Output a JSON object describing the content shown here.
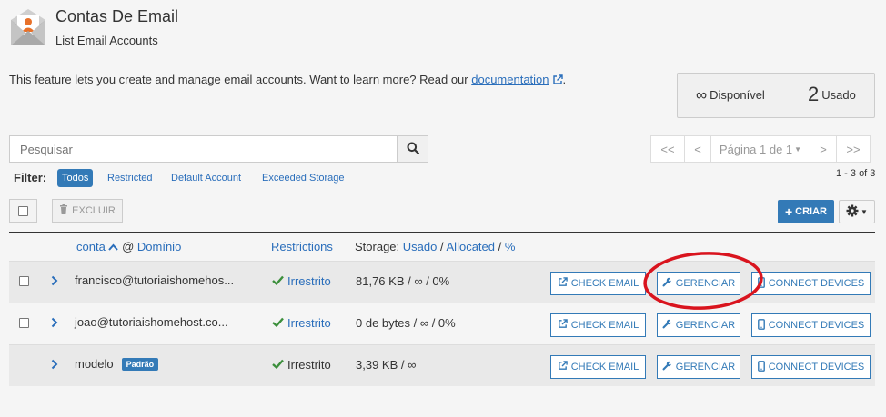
{
  "header": {
    "title": "Contas De Email",
    "subtitle": "List Email Accounts"
  },
  "intro": {
    "text": "This feature lets you create and manage email accounts. Want to learn more? Read our ",
    "link": "documentation",
    "suffix": "."
  },
  "stats": {
    "available_value": "∞",
    "available_label": "Disponível",
    "used_value": "2",
    "used_label": "Usado"
  },
  "search": {
    "placeholder": "Pesquisar"
  },
  "pagination": {
    "first": "<<",
    "prev": "<",
    "page_label": "Página 1 de 1",
    "next": ">",
    "last": ">>",
    "count": "1 - 3 of 3"
  },
  "filters": {
    "label": "Filter:",
    "items": [
      "Todos",
      "Restricted",
      "Default Account",
      "Exceeded Storage"
    ],
    "active": "Todos"
  },
  "toolbar": {
    "delete_label": "EXCLUIR",
    "create_label": "CRIAR"
  },
  "table": {
    "headers": {
      "account": "conta",
      "at": "@",
      "domain": "Domínio",
      "restrictions": "Restrictions",
      "storage_prefix": "Storage:",
      "storage_used": "Usado",
      "storage_sep1": "/",
      "storage_allocated": "Allocated",
      "storage_sep2": "/",
      "storage_pct": "%"
    },
    "rows": [
      {
        "email": "francisco@tutoriaishomehos...",
        "restriction": "Irrestrito",
        "storage": "81,76 KB / ∞ / 0%",
        "check_email": "CHECK EMAIL",
        "manage": "GERENCIAR",
        "connect": "CONNECT DEVICES"
      },
      {
        "email": "joao@tutoriaishomehost.co...",
        "restriction": "Irrestrito",
        "storage": "0 de bytes / ∞ / 0%",
        "check_email": "CHECK EMAIL",
        "manage": "GERENCIAR",
        "connect": "CONNECT DEVICES"
      },
      {
        "email": "modelo",
        "badge": "Padrão",
        "restriction": "Irrestrito",
        "storage": "3,39 KB / ∞",
        "check_email": "CHECK EMAIL",
        "manage": "GERENCIAR",
        "connect": "CONNECT DEVICES"
      }
    ]
  },
  "colors": {
    "primary": "#337ab7",
    "link": "#2a6ebb",
    "success": "#3c8f3c",
    "annotation": "#d9141e"
  }
}
